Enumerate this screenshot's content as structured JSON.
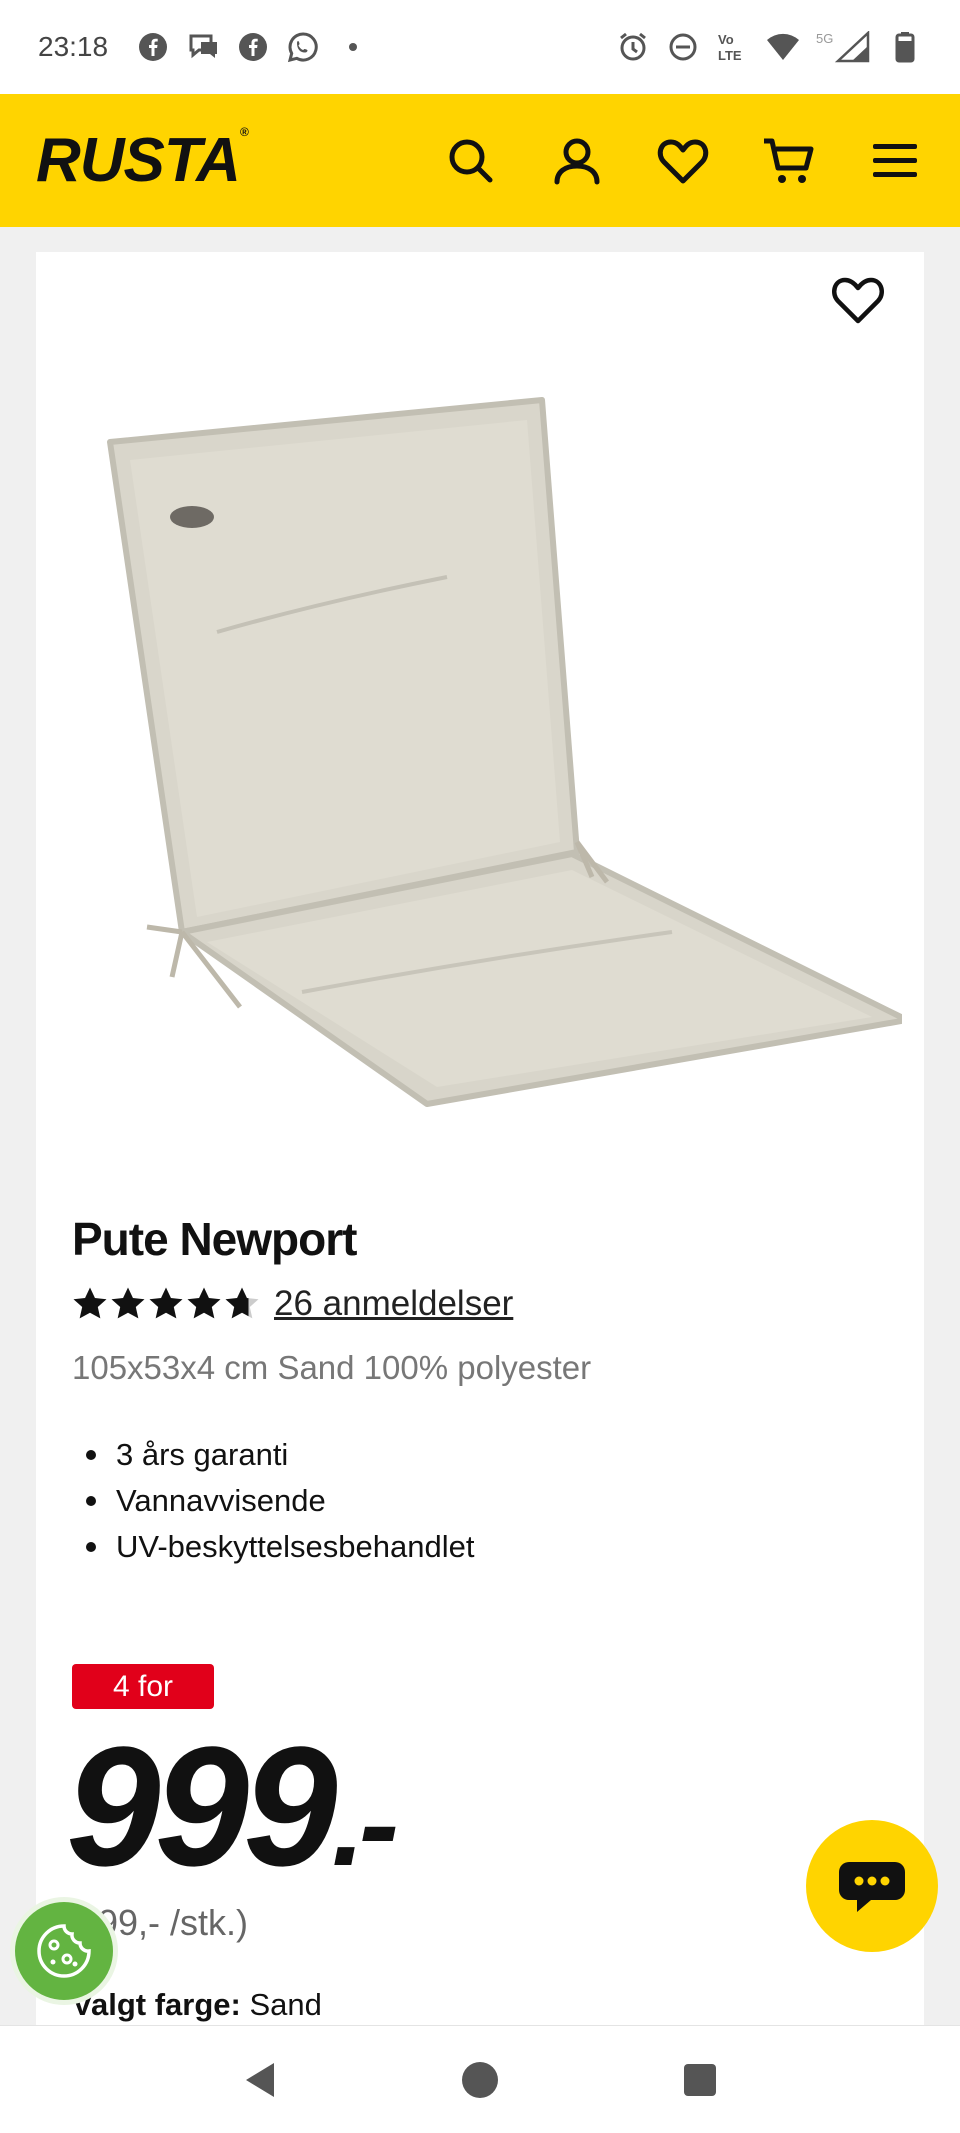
{
  "status_bar": {
    "time": "23:18",
    "left_icons": [
      "facebook-icon",
      "messenger-icon",
      "facebook-icon",
      "whatsapp-icon",
      "dot-icon"
    ],
    "right_icons": [
      "alarm-icon",
      "dnd-icon",
      "volte-icon",
      "wifi-icon",
      "signal-5g-icon",
      "battery-icon"
    ],
    "network_label": "5G",
    "volte_label": "Vo LTE"
  },
  "header": {
    "logo": "RUSTA",
    "icons": [
      "search-icon",
      "account-icon",
      "favorites-icon",
      "cart-icon",
      "menu-icon"
    ],
    "background": "#ffd400"
  },
  "product": {
    "title": "Pute Newport",
    "rating": 4.7,
    "rating_max": 5,
    "reviews_label": "26 anmeldelser",
    "spec": "105x53x4 cm Sand 100% polyester",
    "features": [
      "3 års garanti",
      "Vannavvisende",
      "UV-beskyttelsesbehandlet"
    ],
    "badge": "4 for",
    "price": "999",
    "price_suffix": ".-",
    "per_unit": "99,- /stk.)",
    "chosen_color_label": "Valgt farge:",
    "chosen_color_value": "Sand",
    "badge_color": "#e1001a",
    "image_alt": "chair-cushion-image"
  },
  "floating": {
    "chat_icon": "chat-icon",
    "cookie_icon": "cookie-icon"
  },
  "nav": [
    "back-icon",
    "home-icon",
    "recents-icon"
  ]
}
